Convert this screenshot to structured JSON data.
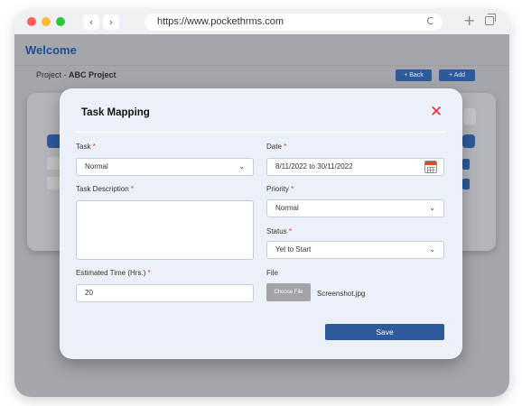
{
  "browser": {
    "url": "https://www.pockethrms.com",
    "back_glyph": "‹",
    "forward_glyph": "›",
    "reload_glyph": "C",
    "new_tab_glyph": "+"
  },
  "page": {
    "welcome": "Welcome",
    "project_prefix": "Project - ",
    "project_name": "ABC Project",
    "back_label": "+ Back",
    "add_label": "+ Add"
  },
  "modal": {
    "title": "Task Mapping",
    "close_glyph": "✕",
    "task": {
      "label": "Task",
      "value": "Normal"
    },
    "date": {
      "label": "Date",
      "value": "8/11/2022 to 30/11/2022"
    },
    "description": {
      "label": "Task Description",
      "value": ""
    },
    "priority": {
      "label": "Priority",
      "value": "Normal"
    },
    "status": {
      "label": "Status",
      "value": "Yet to Start"
    },
    "estimated": {
      "label": "Estimated Time (Hrs.)",
      "value": "20"
    },
    "file": {
      "label": "File",
      "button": "Choose File",
      "filename": "Screenshot.jpg"
    },
    "required_marker": "*",
    "chevron_glyph": "⌄",
    "save_label": "Save"
  },
  "colors": {
    "accent": "#2d5a9a",
    "required": "#e0313a",
    "welcome": "#1d4f91"
  }
}
